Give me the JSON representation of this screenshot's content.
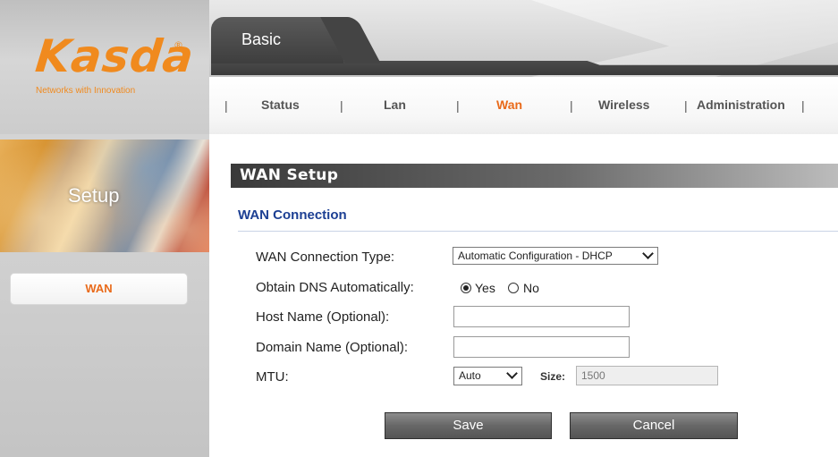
{
  "brand": {
    "logo_text": "Kasda",
    "registered_mark": "®",
    "tagline": "Networks with Innovation",
    "accent_color": "#f08a1e"
  },
  "sidebar": {
    "section_title": "Setup",
    "items": [
      {
        "label": "WAN",
        "active": true
      }
    ]
  },
  "header": {
    "active_tab": "Basic",
    "nav": [
      {
        "label": "Status",
        "active": false
      },
      {
        "label": "Lan",
        "active": false
      },
      {
        "label": "Wan",
        "active": true
      },
      {
        "label": "Wireless",
        "active": false
      },
      {
        "label": "Administration",
        "active": false
      }
    ],
    "separator": "|"
  },
  "main": {
    "section_title": "WAN Setup",
    "subsection_title": "WAN Connection",
    "fields": {
      "wan_type": {
        "label": "WAN Connection Type:",
        "value": "Automatic Configuration - DHCP"
      },
      "obtain_dns": {
        "label": "Obtain DNS Automatically:",
        "options": [
          "Yes",
          "No"
        ],
        "selected": "Yes"
      },
      "host_name": {
        "label": "Host Name (Optional):",
        "value": ""
      },
      "domain_name": {
        "label": "Domain Name (Optional):",
        "value": ""
      },
      "mtu": {
        "label": "MTU:",
        "value": "Auto",
        "size_label": "Size:",
        "size_value": "1500"
      }
    },
    "buttons": {
      "save": "Save",
      "cancel": "Cancel"
    }
  }
}
